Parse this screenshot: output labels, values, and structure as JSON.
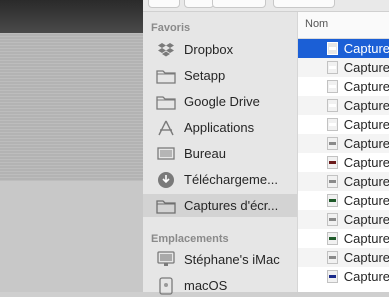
{
  "sidebar": {
    "favorites_title": "Favoris",
    "favorites": [
      {
        "label": "Dropbox",
        "icon": "dropbox-icon"
      },
      {
        "label": "Setapp",
        "icon": "folder-icon"
      },
      {
        "label": "Google Drive",
        "icon": "folder-icon"
      },
      {
        "label": "Applications",
        "icon": "applications-icon"
      },
      {
        "label": "Bureau",
        "icon": "desktop-icon"
      },
      {
        "label": "Téléchargeme...",
        "icon": "downloads-icon"
      },
      {
        "label": "Captures d'écr...",
        "icon": "folder-icon",
        "selected": true
      }
    ],
    "locations_title": "Emplacements",
    "locations": [
      {
        "label": "Stéphane's iMac",
        "icon": "imac-icon"
      },
      {
        "label": "macOS",
        "icon": "disk-icon"
      }
    ]
  },
  "list": {
    "column_name": "Nom",
    "rows": [
      {
        "name": "Capture",
        "selected": true,
        "thumb": "#ffffff"
      },
      {
        "name": "Capture",
        "thumb": "#ffffff"
      },
      {
        "name": "Capture",
        "thumb": "#ffffff"
      },
      {
        "name": "Capture",
        "thumb": "#ffffff"
      },
      {
        "name": "Capture",
        "thumb": "#ffffff"
      },
      {
        "name": "Capture",
        "thumb": "#8a8a8a"
      },
      {
        "name": "Capture",
        "thumb": "#6b1a1a"
      },
      {
        "name": "Capture",
        "thumb": "#8a8a8a"
      },
      {
        "name": "Capture",
        "thumb": "#1f5a2a"
      },
      {
        "name": "Capture",
        "thumb": "#8a8a8a"
      },
      {
        "name": "Capture",
        "thumb": "#1f5a2a"
      },
      {
        "name": "Capture",
        "thumb": "#8a8a8a"
      },
      {
        "name": "Capture",
        "thumb": "#1a2a8a"
      }
    ]
  }
}
